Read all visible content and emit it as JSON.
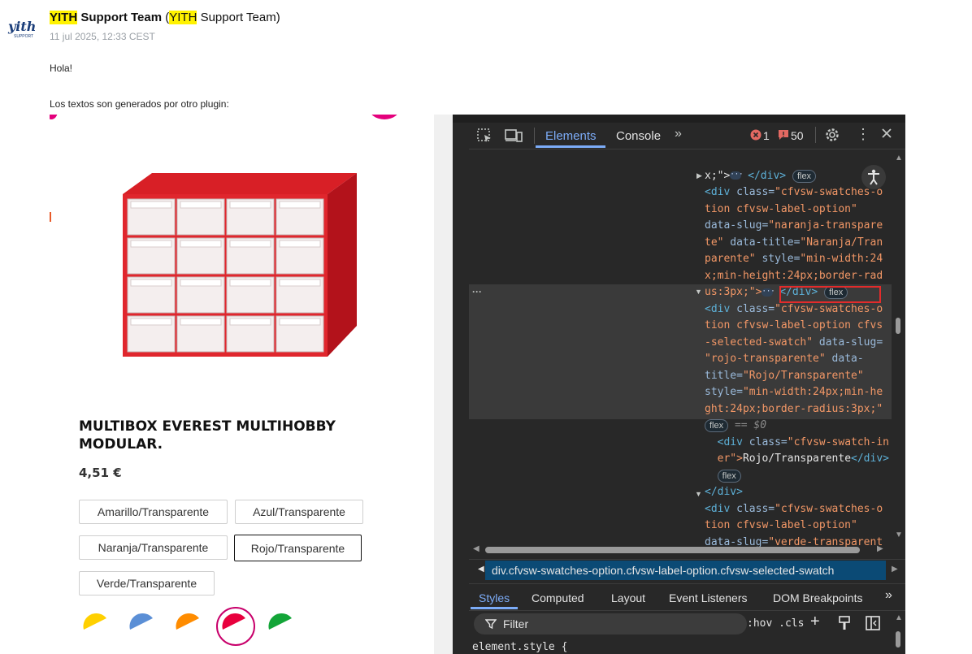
{
  "email": {
    "sender_name_hl": "YITH",
    "sender_name_rest": " Support Team",
    "sender_paren_open": " (",
    "sender_alias_hl": "YITH",
    "sender_alias_rest": " Support Team)",
    "date": "11 jul 2025, 12:33 CEST",
    "greeting": "Hola!",
    "body_line": "Los textos son generados por otro plugin:",
    "logo_text": "yith",
    "logo_sub": "SUPPORT"
  },
  "product": {
    "title_line1": "MULTIBOX EVEREST MULTIHOBBY",
    "title_line2": "MODULAR.",
    "price": "4,51 €",
    "swatches": [
      "Amarillo/Transparente",
      "Azul/Transparente",
      "Naranja/Transparente",
      "Rojo/Transparente",
      "Verde/Transparente"
    ],
    "selected_swatch": "Rojo/Transparente",
    "color_dots": [
      "#ffd000",
      "#5b8fd6",
      "#ff8c00",
      "#e8003d",
      "#13a538"
    ]
  },
  "devtools": {
    "tabs": [
      "Elements",
      "Console"
    ],
    "active_tab": "Elements",
    "error_count": "1",
    "issue_count": "50",
    "breadcrumb": "div.cfvsw-swatches-option.cfvsw-label-option.cfvsw-selected-swatch",
    "styles_tabs": [
      "Styles",
      "Computed",
      "Layout",
      "Event Listeners",
      "DOM Breakpoints"
    ],
    "active_styles_tab": "Styles",
    "filter_placeholder": "Filter",
    "hov_cls": ":hov .cls",
    "element_style": "element.style {",
    "flex_badge": "flex",
    "dollar_zero": "== $0",
    "code": {
      "l1": "x;\">",
      "l1b": "</div>",
      "l2a": "<div ",
      "l2b": "class=",
      "l2c": "\"cfvsw-swatches-o",
      "l3": "tion cfvsw-label-option\"",
      "l4a": "data-slug=",
      "l4b": "\"naranja-transpare",
      "l5a": "te\"",
      "l5b": " data-title=",
      "l5c": "\"Naranja/Tran",
      "l6a": "parente\"",
      "l6b": " style=",
      "l6c": "\"min-width:24",
      "l7": "x;min-height:24px;border-rad",
      "l8": "us:3px;\">",
      "l8b": "</div>",
      "s1a": "<div ",
      "s1b": "class=",
      "s1c": "\"cfvsw-swatches-o",
      "s2": "tion cfvsw-label-option cfvs",
      "s3a": "-selected-swatch\"",
      "s3b": " data-slug=",
      "s4": "\"rojo-transparente\"",
      "s4b": " data-",
      "s5a": "title=",
      "s5b": "\"Rojo/Transparente\"",
      "s6a": "style=",
      "s6b": "\"min-width:24px;min-he",
      "s7": "ght:24px;border-radius:3px;\"",
      "c1a": "<div ",
      "c1b": "class=",
      "c1c": "\"cfvsw-swatch-in",
      "c2a": "er\">",
      "c2b": "Rojo/Transparente",
      "c2c": "</div>",
      "c3": "</div>",
      "g1a": "<div ",
      "g1b": "class=",
      "g1c": "\"cfvsw-swatches-o",
      "g2": "tion cfvsw-label-option\"",
      "g3a": "data-slug=",
      "g3b": "\"verde-transparent"
    }
  }
}
